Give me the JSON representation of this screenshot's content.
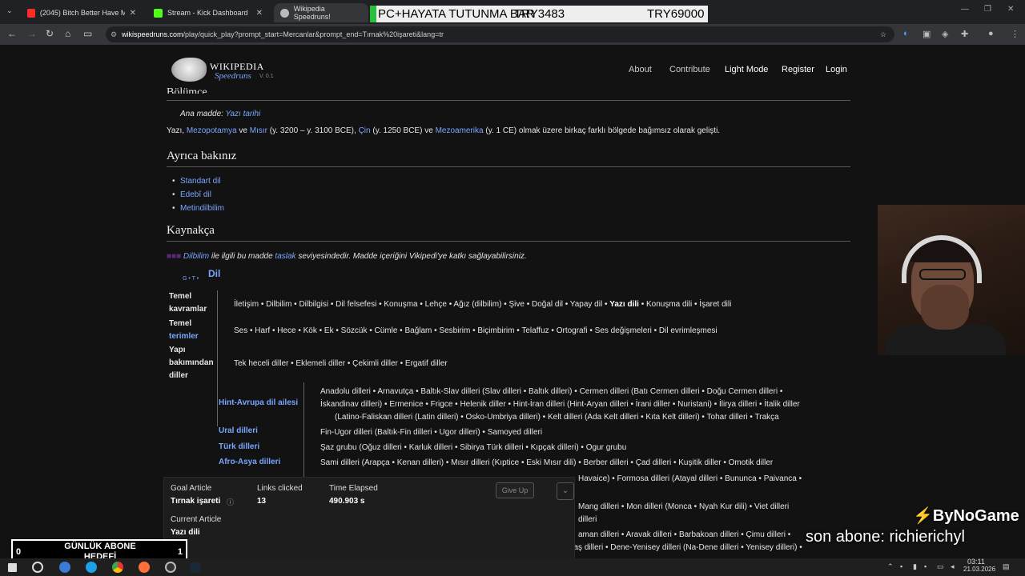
{
  "browser": {
    "tabs": [
      {
        "label": "(2045) Bitch Better Have My M",
        "color": "#ff2b2b"
      },
      {
        "label": "Stream - Kick Dashboard",
        "color": "#53fc18"
      },
      {
        "label": "Wikipedia Speedruns!",
        "color": "#bbbbbb"
      }
    ],
    "url_host": "wikispeedruns.com",
    "url_path": "/play/quick_play?prompt_start=Mercanlar&prompt_end=Tırnak%20işareti&lang=tr"
  },
  "overlay_top": {
    "left": "PC+HAYATA TUTUNMA BAR",
    "mid": "TRY3483",
    "right": "TRY69000"
  },
  "site": {
    "title": "WIKIPEDIA",
    "subtitle": "Speedruns",
    "version": "V. 0.1",
    "menu": [
      "About",
      "Contribute",
      "Light Mode",
      "Register",
      "Login"
    ]
  },
  "article": {
    "partial_heading": "Bölümçe",
    "main_article_prefix": "Ana madde:",
    "main_article_link": "Yazı tarihi",
    "para": {
      "t1": "Yazı,",
      "l1": "Mezopotamya",
      "t2": "ve",
      "l2": "Mısır",
      "t3": "(y. 3200 – y. 3100 BCE),",
      "l3": "Çin",
      "t4": "(y. 1250 BCE) ve",
      "l4": "Mezoamerika",
      "t5": "(y. 1 CE) olmak üzere birkaç farklı bölgede bağımsız olarak gelişti."
    },
    "see_also_heading": "Ayrıca bakınız",
    "see_also": [
      "Standart dil",
      "Edebî dil",
      "Metindilbilim"
    ],
    "refs_heading": "Kaynakça",
    "stub": {
      "pre": "Dilbilim",
      "text": "ile ilgili bu madde",
      "link": "taslak",
      "post": "seviyesindedir. Madde içeriğini Vikipedi'ye katkı sağlayabilirsiniz."
    }
  },
  "navbox": {
    "vte": "G • T •",
    "title": "Dil",
    "rows": [
      {
        "label_a": "Temel",
        "label_b": "kavramlar",
        "content": "İletişim • Dilbilim • Dilbilgisi • Dil felsefesi • Konuşma • Lehçe • Ağız (dilbilim) • Şive • Doğal dil • Yapay dil •",
        "bold": "Yazı dili",
        "content2": "• Konuşma dili • İşaret dili"
      },
      {
        "label_a": "Temel",
        "label_b": "terimler",
        "content": "Ses • Harf • Hece • Kök • Ek • Sözcük • Cümle • Bağlam • Sesbirim • Biçimbirim • Telaffuz • Ortografi • Ses değişmeleri •",
        "content2": "Dil evrimleşmesi"
      },
      {
        "label_a": "Yapı",
        "label_b": "bakımından",
        "label_c": "diller",
        "content": "Tek heceli diller • Eklemeli diller •",
        "content2": "Çekimli diller •",
        "content3": "Ergatif diller"
      }
    ],
    "families": [
      {
        "name": "Hint-Avrupa dil ailesi",
        "lines": [
          "Anadolu dilleri • Arnavutça • Baltık-Slav dilleri    (Slav dilleri • Baltık dilleri) • Cermen dilleri    (Batı Cermen dilleri • Doğu Cermen dilleri •",
          "İskandinav dilleri) • Ermenice • Frigce • Helenik diller • Hint-İran dilleri    (Hint-Aryan dilleri • İrani diller • Nuristani) • İlirya dilleri • İtalik diller",
          "(Latino-Faliskan dilleri (Latin dilleri) • Osko-Umbriya dilleri) • Kelt dilleri    (Ada Kelt dilleri • Kıta Kelt dilleri) • Tohar dilleri • Trakça"
        ]
      },
      {
        "name": "Ural dilleri",
        "lines": [
          "Fin-Ugor dilleri    (Baltık-Fin dilleri • Ugor dilleri) • Samoyed dilleri"
        ]
      },
      {
        "name": "Türk dilleri",
        "lines": [
          "Şaz grubu    (Oğuz dilleri • Karluk dilleri • Sibirya Türk dilleri • Kıpçak dilleri) • Ogur grubu"
        ]
      },
      {
        "name": "Afro-Asya dilleri",
        "lines": [
          "Sami dilleri    (Arapça • Kenan dilleri) • Mısır dilleri    (Kıptice • Eski Mısır dili) • Berber dilleri • Çad dilleri • Kuşitik diller • Omotik diller"
        ]
      }
    ],
    "hidden_tail_1": "Havaice) • Formosa dilleri    (Atayal dilleri • Bununca • Paivanca •",
    "hidden_tail_2": "Mang dilleri • Mon dilleri    (Monca • Nyah Kur dili) • Viet dilleri",
    "hidden_tail_3": "dilleri",
    "hidden_tail_4": "aman dilleri • Aravak dilleri • Barbakoan dilleri • Çimu dilleri •",
    "last_line": "Çin-Tibet dilleri • Çoko dilleri • Çon dilleri • Çukçi-Kamçatka dilleri • Çumaş dilleri • Dene-Yenisey dilleri    (Na-Dene dilleri • Yenisey dilleri) •"
  },
  "game": {
    "goal_label": "Goal Article",
    "goal_value": "Tırnak işareti",
    "links_label": "Links clicked",
    "links_value": "13",
    "time_label": "Time Elapsed",
    "time_value": "490.903 s",
    "give_up": "Give Up",
    "current_label": "Current Article",
    "current_value": "Yazı dili"
  },
  "stream": {
    "bynogame": "ByNoGame",
    "last_sub": "son abone: richierichyl",
    "goal_left": "0",
    "goal_title": "GÜNLÜK ABONE HEDEFİ",
    "goal_right": "1"
  },
  "taskbar": {
    "time": "03:11",
    "date": "21.03.2026"
  }
}
